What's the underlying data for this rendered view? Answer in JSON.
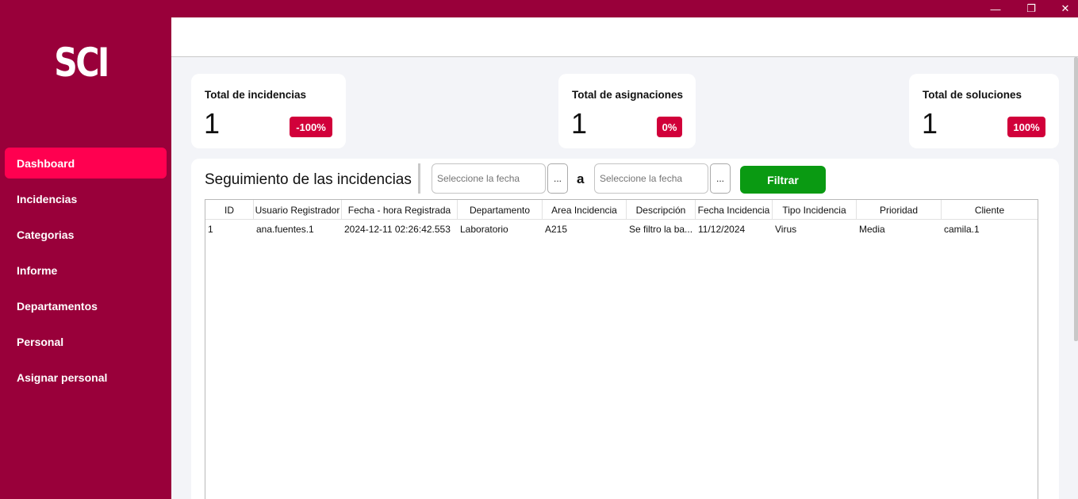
{
  "window": {
    "minimize_glyph": "—",
    "maximize_glyph": "❐",
    "close_glyph": "✕"
  },
  "sidebar": {
    "logo": "SCI",
    "items": [
      {
        "label": "Dashboard",
        "active": true
      },
      {
        "label": "Incidencias",
        "active": false
      },
      {
        "label": "Categorias",
        "active": false
      },
      {
        "label": "Informe",
        "active": false
      },
      {
        "label": "Departamentos",
        "active": false
      },
      {
        "label": "Personal",
        "active": false
      },
      {
        "label": "Asignar personal",
        "active": false
      }
    ]
  },
  "stats": [
    {
      "title": "Total de incidencias",
      "value": "1",
      "badge": "-100%"
    },
    {
      "title": "Total de asignaciones",
      "value": "1",
      "badge": "0%"
    },
    {
      "title": "Total de soluciones",
      "value": "1",
      "badge": "100%"
    }
  ],
  "tracking": {
    "title": "Seguimiento de las incidencias",
    "date_from_placeholder": "Seleccione la fecha",
    "date_to_placeholder": "Seleccione la fecha",
    "picker_label": "...",
    "separator": "a",
    "filter_label": "Filtrar"
  },
  "table": {
    "columns": [
      "ID",
      "Usuario Registrador",
      "Fecha - hora Registrada",
      "Departamento",
      "Area Incidencia",
      "Descripción",
      "Fecha Incidencia",
      "Tipo Incidencia",
      "Prioridad",
      "Cliente"
    ],
    "rows": [
      [
        "1",
        "ana.fuentes.1",
        "2024-12-11 02:26:42.553",
        "Laboratorio",
        "A215",
        "Se filtro la ba...",
        "11/12/2024",
        "Virus",
        "Media",
        "camila.1"
      ]
    ]
  },
  "colors": {
    "brand": "#99003a",
    "active_nav": "#ff0050",
    "badge": "#d1003a",
    "filter_button": "#0a9a12",
    "content_bg": "#f3f4f8"
  }
}
